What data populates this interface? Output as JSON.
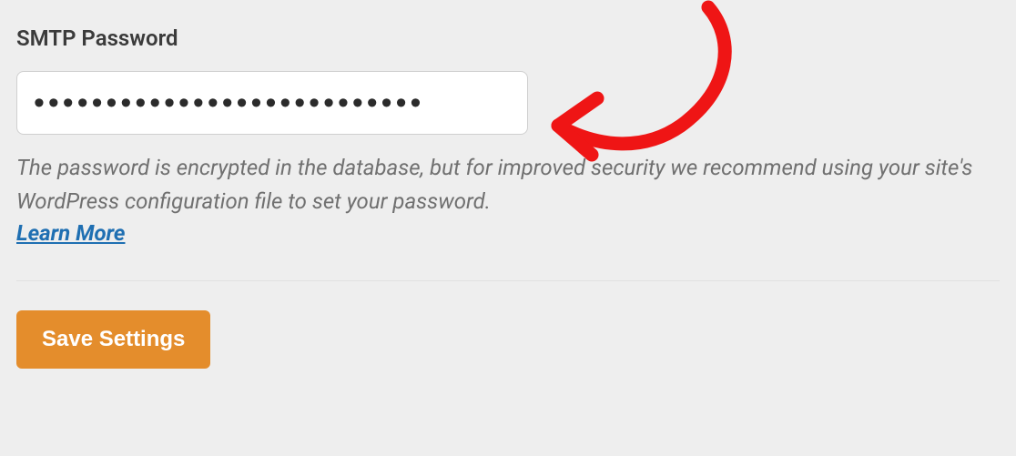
{
  "field": {
    "label": "SMTP Password",
    "value": "•••••••••••••••••••••••••••",
    "helper": "The password is encrypted in the database, but for improved security we recommend using your site's WordPress configuration file to set your password.",
    "learn_more": "Learn More"
  },
  "actions": {
    "save": "Save Settings"
  },
  "annotation": {
    "icon": "hand-drawn-arrow",
    "color": "#ef1515"
  }
}
